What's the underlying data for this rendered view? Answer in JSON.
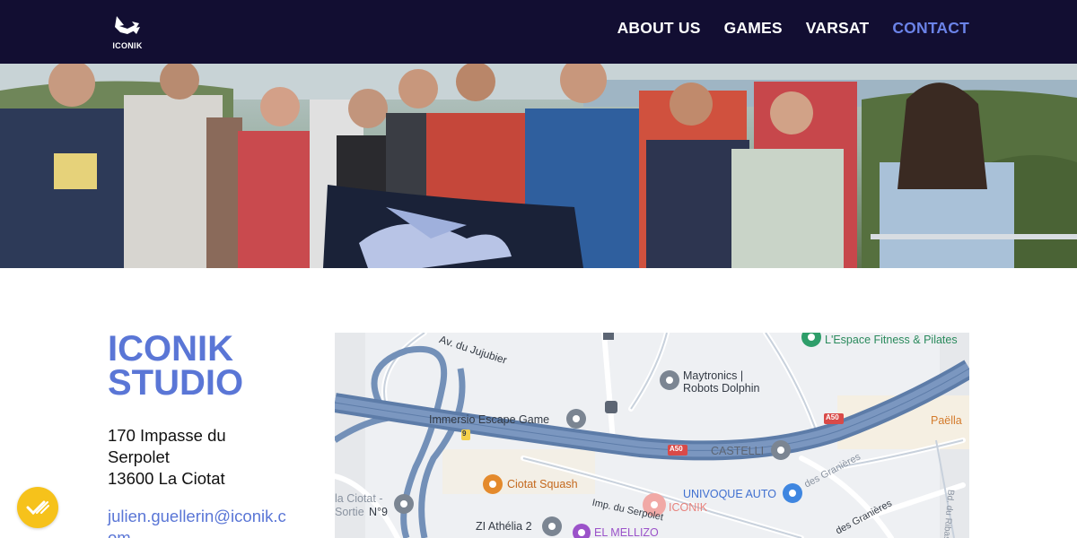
{
  "header": {
    "logo_text": "ICONIK",
    "nav": [
      {
        "label": "ABOUT US",
        "active": false
      },
      {
        "label": "GAMES",
        "active": false
      },
      {
        "label": "VARSAT",
        "active": false
      },
      {
        "label": "CONTACT",
        "active": true
      }
    ],
    "colors": {
      "background": "#120e32",
      "active": "#6b83e8"
    }
  },
  "studio": {
    "title_line1": "ICONIK",
    "title_line2": "STUDIO",
    "address_line1": "170 Impasse du",
    "address_line2": "Serpolet",
    "address_line3": "13600 La Ciotat",
    "email": "julien.guellerin@iconik.com"
  },
  "map": {
    "labels": {
      "jujubier": "Av. du Jujubier",
      "maytronics1": "Maytronics |",
      "maytronics2": "Robots Dolphin",
      "escape": "Immersio Escape Game",
      "espace": "L'Espace Fitness & Pilates",
      "a50_1": "A50",
      "a50_2": "A50",
      "castelli": "CASTELLI",
      "paella": "Paëlla",
      "squash": "Ciotat Squash",
      "univoque": "UNIVOQUE AUTO",
      "serpolet": "Imp. du Serpolet",
      "iconik": "ICONIK",
      "granieres1": "des Granières",
      "granieres2": "des Granières",
      "ribas": "Bd. du Ribas",
      "sortie1": "la Ciotat -",
      "sortie2": "Sortie",
      "n9": "N°9",
      "athelia": "ZI Athélia 2",
      "mellizo": "EL MELLIZO",
      "route9": "9"
    }
  },
  "fab": {
    "icon": "accessibility-check-icon",
    "color": "#f6c21b"
  }
}
